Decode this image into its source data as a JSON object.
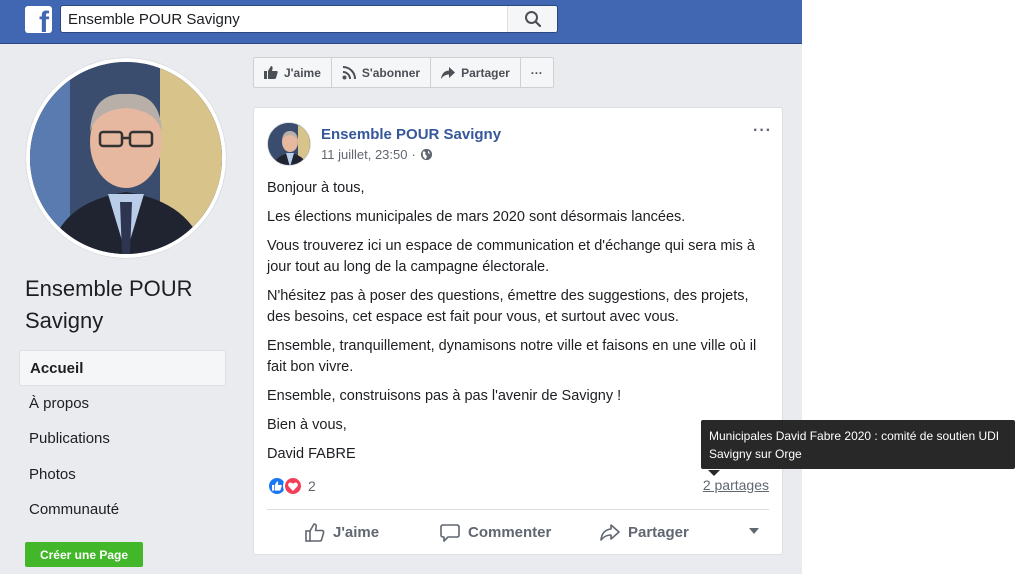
{
  "topbar": {
    "logo": "f",
    "search_value": "Ensemble POUR Savigny",
    "search_icon": "search-icon"
  },
  "page": {
    "name": "Ensemble POUR Savigny"
  },
  "nav": {
    "items": [
      {
        "label": "Accueil",
        "active": true
      },
      {
        "label": "À propos",
        "active": false
      },
      {
        "label": "Publications",
        "active": false
      },
      {
        "label": "Photos",
        "active": false
      },
      {
        "label": "Communauté",
        "active": false
      }
    ],
    "create_page_label": "Créer une Page"
  },
  "actionbar": {
    "like_label": "J'aime",
    "follow_label": "S'abonner",
    "share_label": "Partager",
    "more_label": "···"
  },
  "post": {
    "author": "Ensemble POUR Savigny",
    "timestamp": "11 juillet, 23:50",
    "separator": "·",
    "paragraphs": [
      "Bonjour à tous,",
      "Les élections municipales de mars 2020 sont désormais lancées.",
      "Vous trouverez ici un espace de communication et d'échange qui sera mis à jour tout au long de la campagne électorale.",
      "N'hésitez pas à poser des questions, émettre des suggestions, des projets, des besoins, cet espace est fait pour vous, et surtout avec vous.",
      "Ensemble, tranquillement, dynamisons notre ville et faisons en une ville où il fait bon vivre.",
      "Ensemble, construisons pas à pas l'avenir de Savigny !",
      "Bien à vous,",
      "David FABRE"
    ],
    "reaction_count": "2",
    "shares": "2 partages",
    "actions": {
      "like": "J'aime",
      "comment": "Commenter",
      "share": "Partager"
    },
    "more": "···"
  },
  "tooltip": {
    "text": "Municipales David Fabre 2020 : comité de soutien UDI Savigny sur Orge"
  },
  "colors": {
    "brand": "#4267b2",
    "link": "#365899",
    "create_button": "#42b72a",
    "like_reaction": "#1877f2",
    "love_reaction": "#f33e58"
  }
}
